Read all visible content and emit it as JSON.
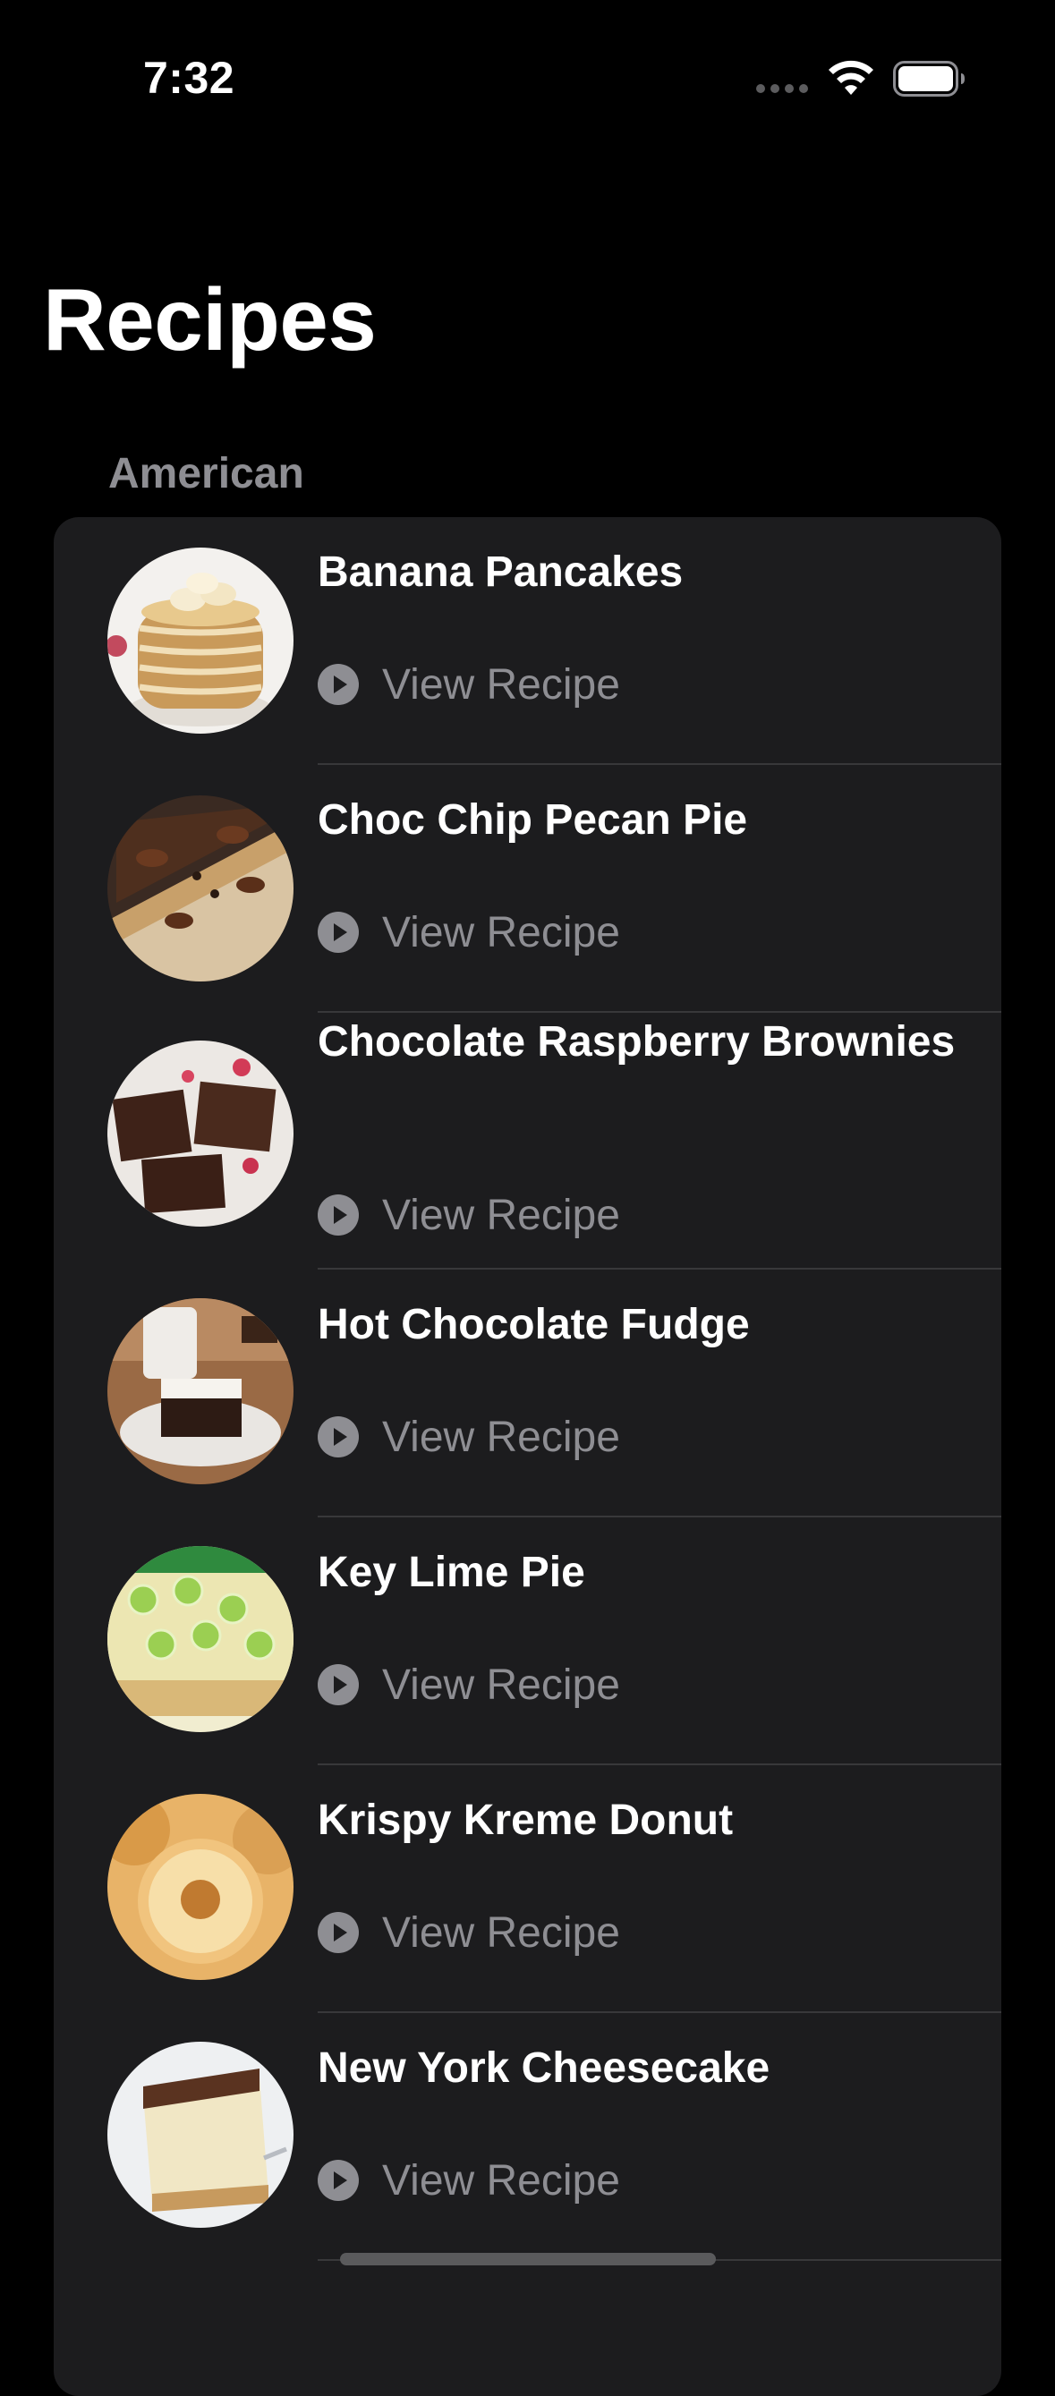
{
  "status_bar": {
    "time": "7:32",
    "icons": [
      "cellular-signal-icon",
      "wifi-icon",
      "battery-icon"
    ]
  },
  "title": "Recipes",
  "section": {
    "header": "American"
  },
  "recipes": [
    {
      "name": "Banana Pancakes",
      "action": "View Recipe",
      "thumb_icon": "pancakes-photo-icon"
    },
    {
      "name": "Choc Chip Pecan Pie",
      "action": "View Recipe",
      "thumb_icon": "pecan-pie-photo-icon"
    },
    {
      "name": "Chocolate Raspberry Brownies",
      "action": "View Recipe",
      "thumb_icon": "brownies-photo-icon"
    },
    {
      "name": "Hot Chocolate Fudge",
      "action": "View Recipe",
      "thumb_icon": "fudge-photo-icon"
    },
    {
      "name": "Key Lime Pie",
      "action": "View Recipe",
      "thumb_icon": "key-lime-pie-photo-icon"
    },
    {
      "name": "Krispy Kreme Donut",
      "action": "View Recipe",
      "thumb_icon": "donut-photo-icon"
    },
    {
      "name": "New York Cheesecake",
      "action": "View Recipe",
      "thumb_icon": "cheesecake-photo-icon"
    }
  ],
  "colors": {
    "background": "#000000",
    "card": "#1c1c1e",
    "secondary_text": "#8e8e93",
    "separator": "#38383a"
  }
}
